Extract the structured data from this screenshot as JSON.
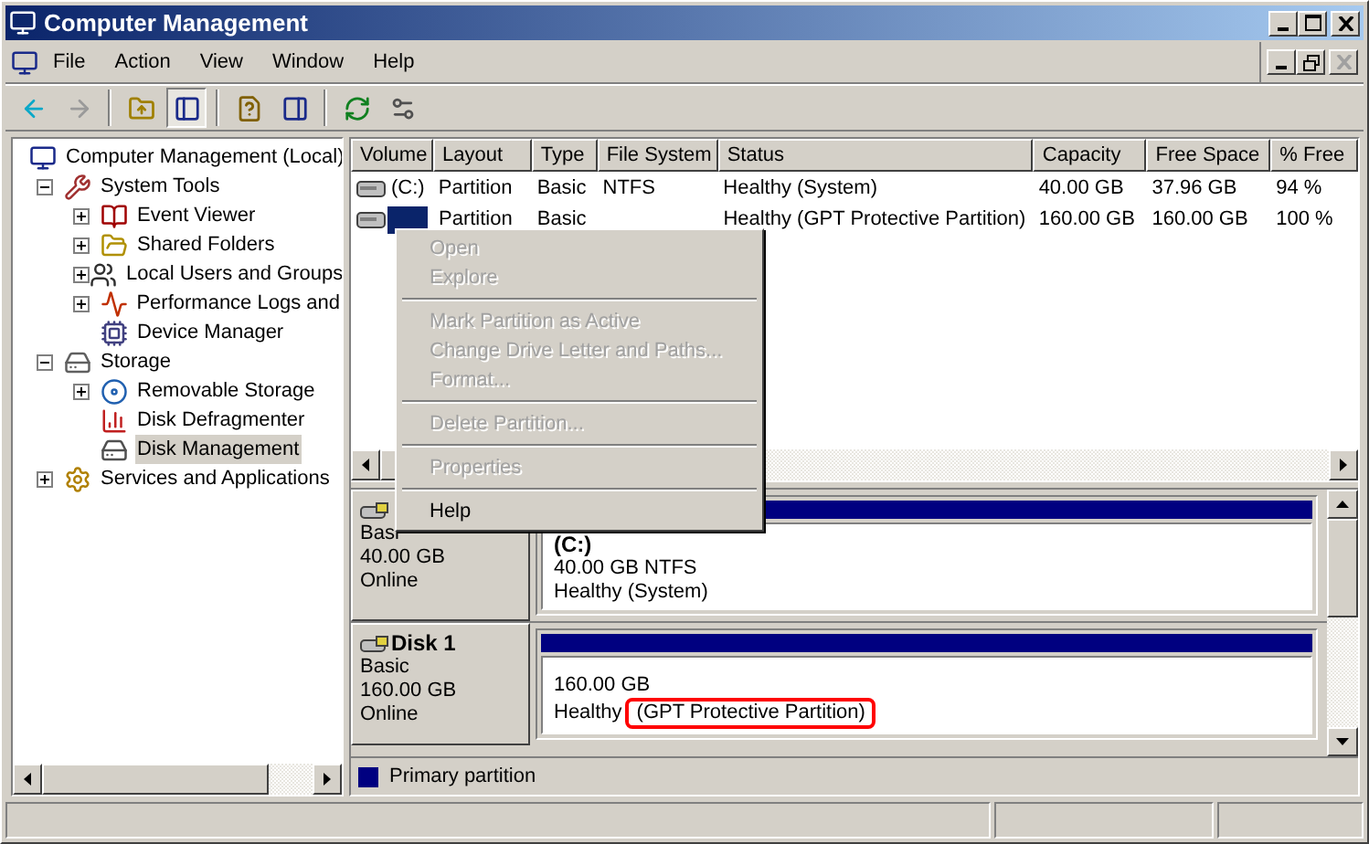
{
  "window": {
    "title": "Computer Management",
    "controls": [
      {
        "kind": "minimize"
      },
      {
        "kind": "maximize"
      },
      {
        "kind": "close"
      }
    ]
  },
  "menu_bar": {
    "items": [
      "File",
      "Action",
      "View",
      "Window",
      "Help"
    ],
    "document_controls": [
      {
        "kind": "minimize",
        "disabled": false
      },
      {
        "kind": "restore",
        "disabled": false
      },
      {
        "kind": "close",
        "disabled": true
      }
    ]
  },
  "toolbar": [
    {
      "kind": "back",
      "disabled": false,
      "pressed": false
    },
    {
      "kind": "forward",
      "disabled": true,
      "pressed": false
    },
    {
      "kind": "separator"
    },
    {
      "kind": "up",
      "disabled": false,
      "pressed": false
    },
    {
      "kind": "tree",
      "disabled": false,
      "pressed": true
    },
    {
      "kind": "separator"
    },
    {
      "kind": "help",
      "disabled": false,
      "pressed": false
    },
    {
      "kind": "pane",
      "disabled": false,
      "pressed": false
    },
    {
      "kind": "separator"
    },
    {
      "kind": "refresh",
      "disabled": false,
      "pressed": false
    },
    {
      "kind": "properties",
      "disabled": false,
      "pressed": false
    }
  ],
  "tree": [
    {
      "label": "Computer Management (Local)",
      "selected": false,
      "children": [
        {
          "label": "System Tools",
          "expanded": true,
          "selected": false,
          "children": [
            {
              "label": "Event Viewer",
              "expanded": false,
              "selected": false
            },
            {
              "label": "Shared Folders",
              "expanded": false,
              "selected": false
            },
            {
              "label": "Local Users and Groups",
              "expanded": false,
              "selected": false
            },
            {
              "label": "Performance Logs and",
              "expanded": false,
              "selected": false
            },
            {
              "label": "Device Manager",
              "selected": false
            }
          ]
        },
        {
          "label": "Storage",
          "expanded": true,
          "selected": false,
          "children": [
            {
              "label": "Removable Storage",
              "expanded": false,
              "selected": false
            },
            {
              "label": "Disk Defragmenter",
              "selected": false
            },
            {
              "label": "Disk Management",
              "selected": true
            }
          ]
        },
        {
          "label": "Services and Applications",
          "expanded": false,
          "selected": false
        }
      ]
    }
  ],
  "volume_list": {
    "columns": [
      "Volume",
      "Layout",
      "Type",
      "File System",
      "Status",
      "Capacity",
      "Free Space",
      "% Free"
    ],
    "rows": [
      {
        "selected": false,
        "cells": [
          "(C:)",
          "Partition",
          "Basic",
          "NTFS",
          "Healthy (System)",
          "40.00 GB",
          "37.96 GB",
          "94 %"
        ]
      },
      {
        "selected": true,
        "cells": [
          null,
          "Partition",
          "Basic",
          null,
          "Healthy (GPT Protective Partition)",
          "160.00 GB",
          "160.00 GB",
          "100 %"
        ]
      }
    ]
  },
  "context_menu": {
    "items": [
      {
        "kind": "item",
        "label": "Open",
        "disabled": true
      },
      {
        "kind": "item",
        "label": "Explore",
        "disabled": true
      },
      {
        "kind": "separator"
      },
      {
        "kind": "item",
        "label": "Mark Partition as Active",
        "disabled": true
      },
      {
        "kind": "item",
        "label": "Change Drive Letter and Paths...",
        "disabled": true
      },
      {
        "kind": "item",
        "label": "Format...",
        "disabled": true
      },
      {
        "kind": "separator"
      },
      {
        "kind": "item",
        "label": "Delete Partition...",
        "disabled": true
      },
      {
        "kind": "separator"
      },
      {
        "kind": "item",
        "label": "Properties",
        "disabled": true
      },
      {
        "kind": "separator"
      },
      {
        "kind": "item",
        "label": "Help",
        "disabled": false
      }
    ]
  },
  "disks": [
    {
      "type": "Basi",
      "size": "40.00 GB",
      "status": "Online",
      "partition": {
        "label": "(C:)",
        "detail": "40.00 GB NTFS",
        "status": "Healthy (System)"
      }
    },
    {
      "name": "Disk 1",
      "type": "Basic",
      "size": "160.00 GB",
      "status": "Online",
      "partition": {
        "detail": "160.00 GB",
        "status": "Healthy",
        "note": "(GPT Protective Partition)",
        "note_highlighted": true
      }
    }
  ],
  "legend": [
    {
      "label": "Primary partition",
      "color": "#000080"
    }
  ]
}
